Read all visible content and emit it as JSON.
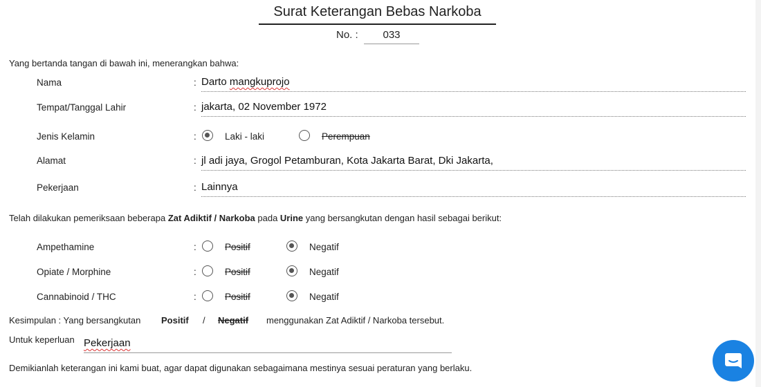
{
  "header": {
    "title": "Surat Keterangan Bebas Narkoba",
    "no_label": "No. :",
    "no_value": "033"
  },
  "intro": "Yang bertanda tangan di bawah ini, menerangkan bahwa:",
  "colon": ":",
  "fields": {
    "nama": {
      "label": "Nama",
      "value_a": "Darto ",
      "value_b": "mangkuprojo"
    },
    "ttl": {
      "label": "Tempat/Tanggal Lahir",
      "value": "jakarta, 02 November 1972"
    },
    "jk": {
      "label": "Jenis Kelamin",
      "opt1": "Laki - laki",
      "opt2": "Perempuan",
      "selected": "Laki - laki"
    },
    "alamat": {
      "label": "Alamat",
      "value": "jl adi jaya, Grogol Petamburan, Kota Jakarta Barat, Dki Jakarta,"
    },
    "pekerjaan": {
      "label": "Pekerjaan",
      "value": "Lainnya"
    }
  },
  "exam": {
    "sentence_a": "Telah dilakukan pemeriksaan beberapa ",
    "sentence_b": "Zat Adiktif / Narkoba",
    "sentence_c": " pada ",
    "sentence_d": "Urine",
    "sentence_e": " yang bersangkutan dengan hasil sebagai berikut:",
    "positive": "Positif",
    "negative": "Negatif",
    "tests": [
      {
        "name": "Ampethamine",
        "result": "Negatif"
      },
      {
        "name": "Opiate / Morphine",
        "result": "Negatif"
      },
      {
        "name": "Cannabinoid / THC",
        "result": "Negatif"
      }
    ]
  },
  "conclusion": {
    "prefix": "Kesimpulan : Yang bersangkutan",
    "positive": "Positif",
    "slash": "/",
    "negative": "Negatif",
    "suffix": "menggunakan Zat Adiktif / Narkoba tersebut."
  },
  "purpose": {
    "label": "Untuk keperluan",
    "value": "Pekerjaan"
  },
  "closing": "Demikianlah keterangan ini kami buat, agar dapat digunakan sebagaimana mestinya sesuai peraturan yang berlaku.",
  "colors": {
    "accent": "#1a82e2"
  },
  "icons": {
    "chat": "chat-bubble-icon"
  }
}
